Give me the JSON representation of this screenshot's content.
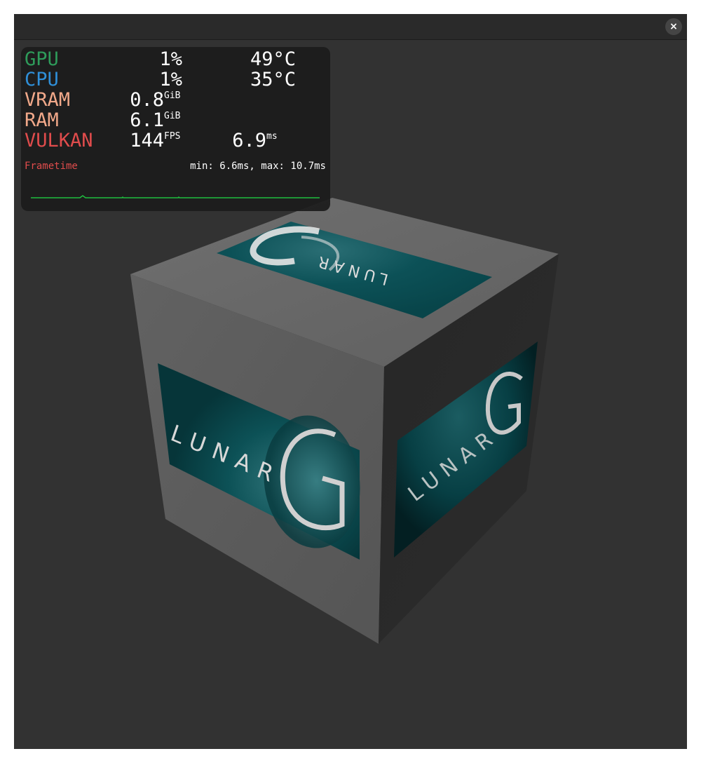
{
  "window": {
    "close_symbol": "×",
    "close_icon": "close-icon"
  },
  "hud": {
    "gpu": {
      "label": "GPU",
      "load": "1%",
      "temp": "49°C"
    },
    "cpu": {
      "label": "CPU",
      "load": "1%",
      "temp": "35°C"
    },
    "vram": {
      "label": "VRAM",
      "value": "0.8",
      "unit": "GiB"
    },
    "ram": {
      "label": "RAM",
      "value": "6.1",
      "unit": "GiB"
    },
    "vulkan": {
      "label": "VULKAN",
      "fps": "144",
      "fps_unit": "FPS",
      "frametime": "6.9",
      "frametime_unit": "ms"
    },
    "frametime": {
      "label": "Frametime",
      "minmax": "min: 6.6ms, max: 10.7ms"
    },
    "colors": {
      "gpu": "#2e9b5a",
      "cpu": "#2f8fd8",
      "vram": "#f2a98a",
      "ram": "#f2a98a",
      "vulkan": "#e04c4c",
      "graph": "#1fbf3f"
    }
  },
  "scene": {
    "logo_text": "LUNAR",
    "logo_letter": "G",
    "cube_face_color": "#6b6b6b",
    "logo_color": "#0d4e54"
  }
}
